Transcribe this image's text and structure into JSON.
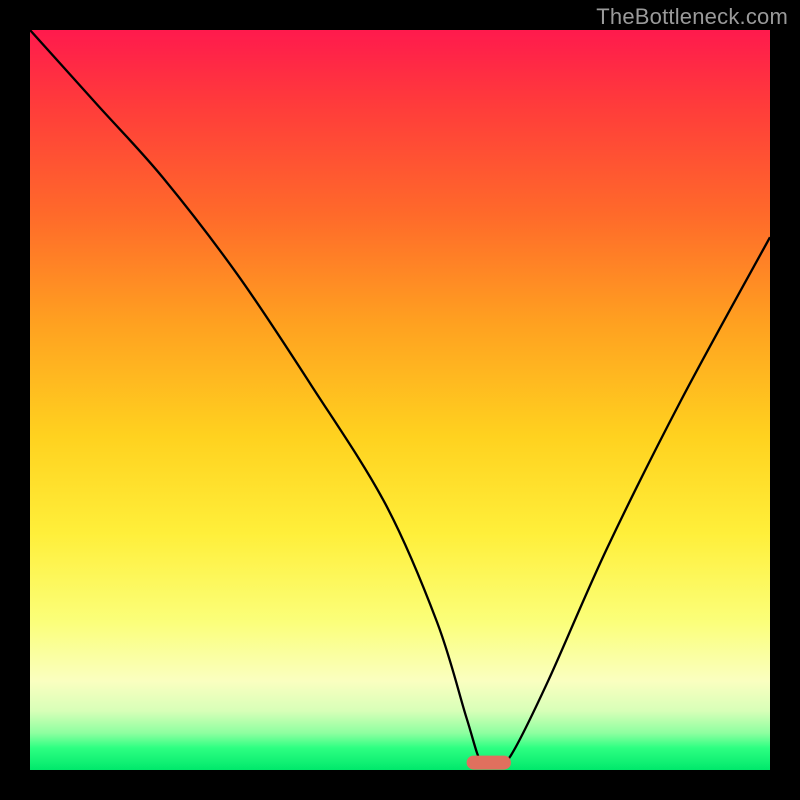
{
  "watermark": "TheBottleneck.com",
  "chart_data": {
    "type": "line",
    "title": "",
    "xlabel": "",
    "ylabel": "",
    "xlim": [
      0,
      100
    ],
    "ylim": [
      0,
      100
    ],
    "grid": false,
    "legend": false,
    "series": [
      {
        "name": "bottleneck-curve",
        "x": [
          0,
          9,
          18,
          28,
          38,
          48,
          55,
          59,
          61,
          63,
          65,
          70,
          78,
          88,
          100
        ],
        "y": [
          100,
          90,
          80,
          67,
          52,
          36,
          20,
          7,
          1,
          1,
          2,
          12,
          30,
          50,
          72
        ]
      }
    ],
    "marker": {
      "name": "optimal-marker",
      "x_center": 62,
      "y": 1,
      "width": 6,
      "color": "#e0705e"
    },
    "background_gradient_stops": [
      {
        "pos": 0,
        "color": "#ff1a4d"
      },
      {
        "pos": 55,
        "color": "#ffd21f"
      },
      {
        "pos": 88,
        "color": "#faffc0"
      },
      {
        "pos": 100,
        "color": "#00e86b"
      }
    ]
  }
}
